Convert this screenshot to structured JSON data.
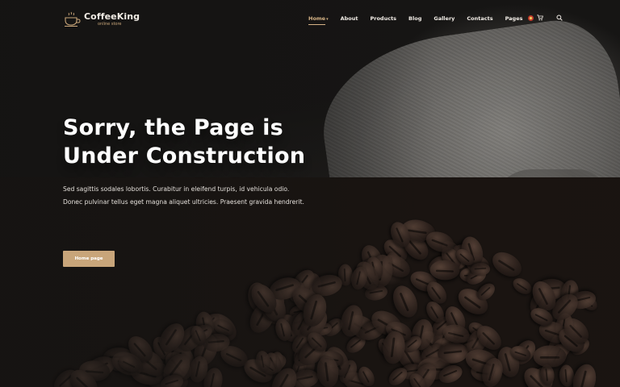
{
  "brand": {
    "name": "CoffeeKing",
    "tagline": "online store",
    "accent_color": "#c8a57a",
    "logo_icon": "coffee-cup-icon"
  },
  "nav": {
    "items": [
      {
        "label": "Home",
        "active": true,
        "has_dropdown": true
      },
      {
        "label": "About"
      },
      {
        "label": "Products"
      },
      {
        "label": "Blog"
      },
      {
        "label": "Gallery"
      },
      {
        "label": "Contacts"
      },
      {
        "label": "Pages"
      }
    ],
    "icons": [
      "flag-icon",
      "cart-icon",
      "search-icon"
    ]
  },
  "hero": {
    "title_line1": "Sorry, the Page is",
    "title_line2": "Under Construction",
    "text": "Sed sagittis sodales lobortis. Curabitur in eleifend turpis, id vehicula odio. Donec pulvinar tellus eget magna aliquet ultricies. Praesent gravida hendrerit.",
    "button_label": "Home page"
  }
}
